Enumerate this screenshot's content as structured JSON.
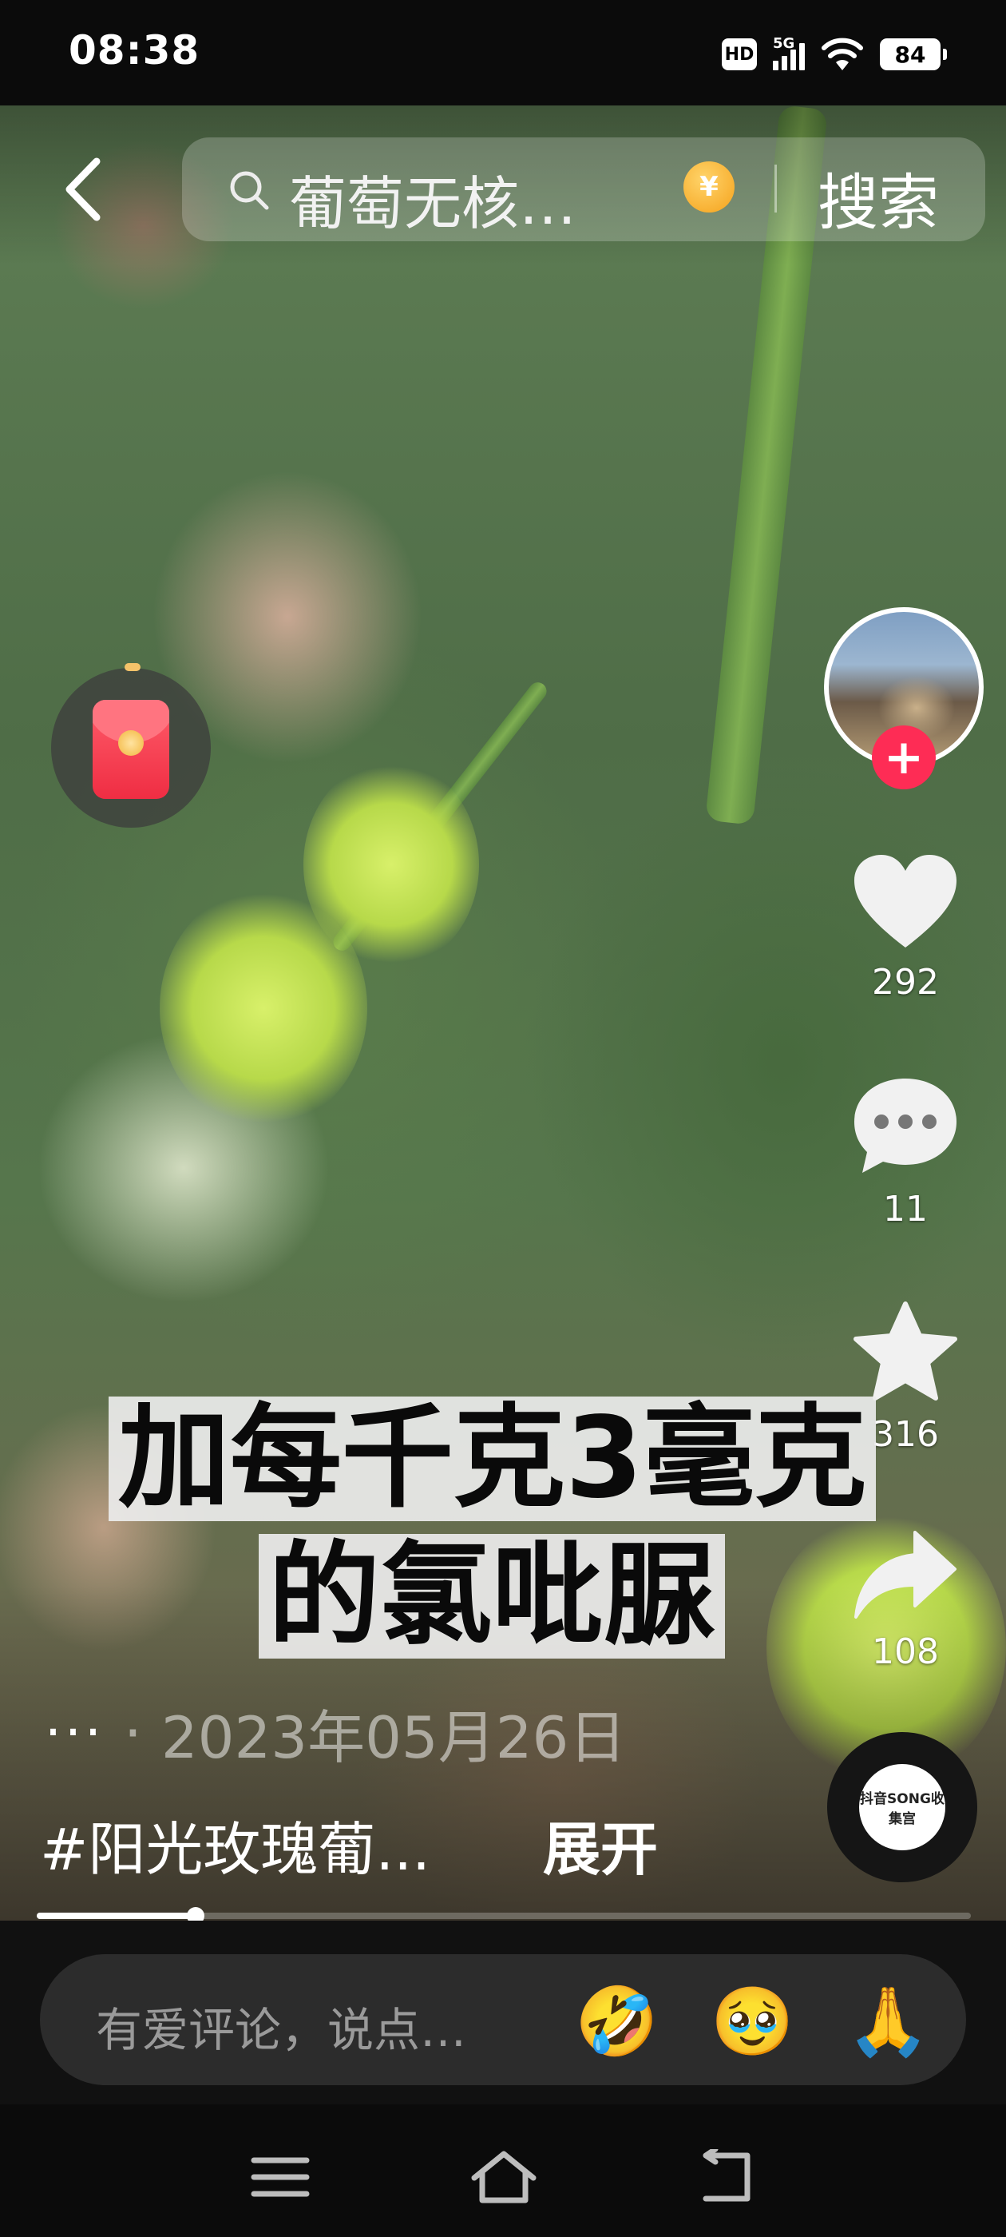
{
  "status_bar": {
    "time": "08:38",
    "network": "5G",
    "hd_label": "HD",
    "battery": "84",
    "icons": [
      "hd-icon",
      "signal-icon",
      "wifi-icon",
      "battery-icon"
    ]
  },
  "top_bar": {
    "back_icon": "back-arrow-icon",
    "search_icon": "search-icon",
    "search_query": "葡萄无核…",
    "coin_symbol": "¥",
    "search_button": "搜索"
  },
  "red_packet": {
    "icon": "red-envelope-icon"
  },
  "creator": {
    "avatar": "creator-avatar",
    "follow_label": "+"
  },
  "actions": {
    "like": {
      "icon": "heart-icon",
      "count": "292"
    },
    "comment": {
      "icon": "comment-icon",
      "count": "11"
    },
    "favorite": {
      "icon": "star-icon",
      "count": "316"
    },
    "share": {
      "icon": "share-icon",
      "count": "108"
    }
  },
  "music": {
    "icon": "music-disc-icon",
    "label": "抖音SONG收集宫"
  },
  "caption": {
    "line1": "加每千克3毫克",
    "line2": "的氯吡脲"
  },
  "meta": {
    "more": "···",
    "separator": "·",
    "date": "2023年05月26日"
  },
  "description": {
    "hashtag": "#阳光玫瑰葡...",
    "expand": "展开"
  },
  "progress": {
    "fraction": 0.17
  },
  "comment_bar": {
    "placeholder": "有爱评论，说点…",
    "emojis": [
      "🤣",
      "🥹",
      "🙏"
    ]
  },
  "nav_bar": {
    "icons": [
      "menu-icon",
      "home-icon",
      "back-icon"
    ]
  },
  "colors": {
    "accent": "#fe2c55",
    "background": "#000000"
  }
}
